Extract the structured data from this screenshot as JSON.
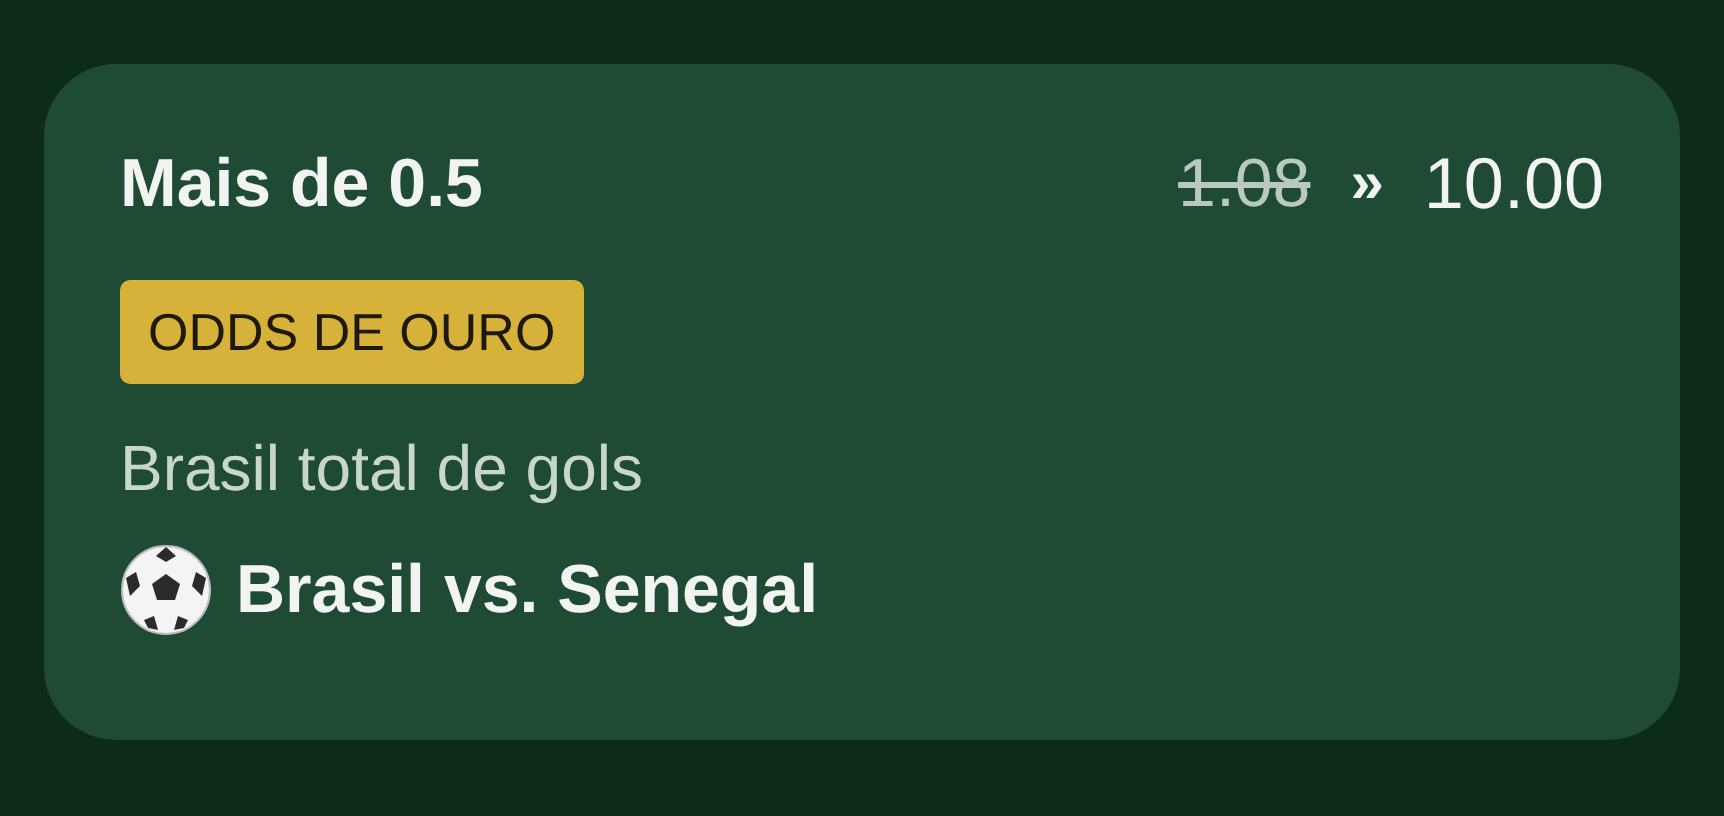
{
  "bet": {
    "selection": "Mais de 0.5",
    "old_odds": "1.08",
    "arrow": "»",
    "new_odds": "10.00",
    "badge": "ODDS DE OURO",
    "market": "Brasil total de gols",
    "kind": "soccer",
    "match": "Brasil vs. Senegal"
  }
}
